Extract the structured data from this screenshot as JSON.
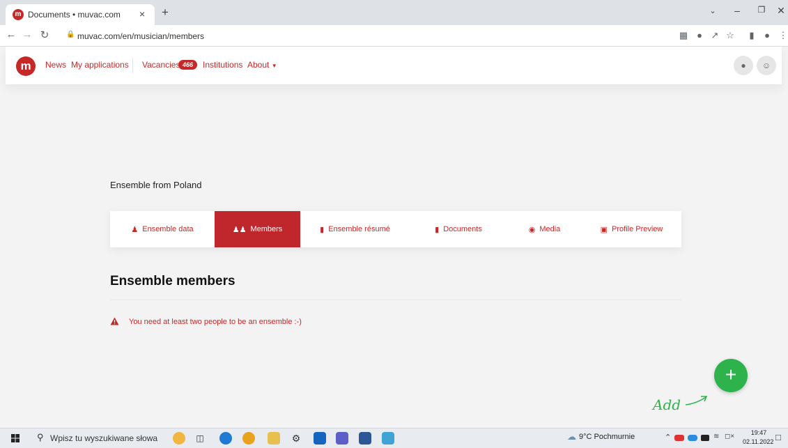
{
  "browser": {
    "tab_title": "Documents • muvac.com",
    "tab_close": "×",
    "new_tab": "+",
    "url": "muvac.com/en/musician/members"
  },
  "header": {
    "logo_letter": "m",
    "nav": {
      "news": "News",
      "my_applications": "My applications",
      "vacancies": "Vacancies",
      "vacancies_count": "466",
      "institutions": "Institutions",
      "about": "About"
    }
  },
  "page": {
    "ensemble_title": "Ensemble from Poland",
    "tabs": [
      {
        "label": "Ensemble data",
        "icon": "user-icon",
        "active": false
      },
      {
        "label": "Members",
        "icon": "users-icon",
        "active": true
      },
      {
        "label": "Ensemble résumé",
        "icon": "file-icon",
        "active": false
      },
      {
        "label": "Documents",
        "icon": "documents-icon",
        "active": false
      },
      {
        "label": "Media",
        "icon": "camera-icon",
        "active": false
      },
      {
        "label": "Profile Preview",
        "icon": "profile-preview-icon",
        "active": false
      }
    ],
    "members_heading": "Ensemble members",
    "warning": "You need at least two people to be an ensemble :-)",
    "add_button": "+",
    "add_hint": "Add"
  },
  "taskbar": {
    "search_placeholder": "Wpisz tu wyszukiwane słowa",
    "weather": "9°C Pochmurnie",
    "time": "19:47",
    "date": "02.11.2022"
  },
  "colors": {
    "brand_red": "#c62828",
    "active_tab": "#c0272d",
    "add_green": "#2eb34c"
  }
}
